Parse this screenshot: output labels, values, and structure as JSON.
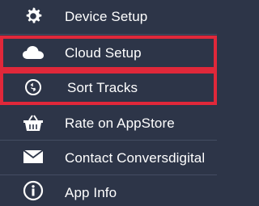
{
  "menu": {
    "items": [
      {
        "label": "Device Setup",
        "icon": "gear-icon",
        "highlighted": false
      },
      {
        "label": "Cloud Setup",
        "icon": "cloud-icon",
        "highlighted": true
      },
      {
        "label": "Sort Tracks",
        "icon": "sort-circle-icon",
        "highlighted": true
      },
      {
        "label": "Rate on AppStore",
        "icon": "basket-icon",
        "highlighted": false
      },
      {
        "label": "Contact Conversdigital",
        "icon": "envelope-icon",
        "highlighted": false
      },
      {
        "label": "App Info",
        "icon": "info-circle-icon",
        "highlighted": false
      }
    ]
  },
  "colors": {
    "background": "#2d3548",
    "highlight": "#e0283a",
    "text": "#ffffff"
  }
}
